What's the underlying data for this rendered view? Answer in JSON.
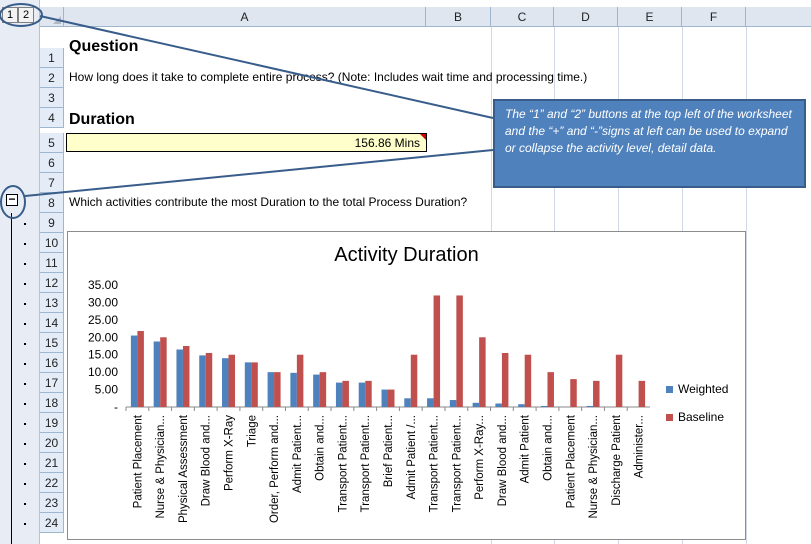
{
  "outline": {
    "level_buttons": [
      "1",
      "2"
    ],
    "collapse_symbol": "−"
  },
  "columns": [
    "A",
    "B",
    "C",
    "D",
    "E",
    "F"
  ],
  "rows": [
    "1",
    "2",
    "3",
    "4",
    "5",
    "6",
    "7",
    "8",
    "9",
    "10",
    "11",
    "12",
    "13",
    "14",
    "15",
    "16",
    "17",
    "18",
    "19",
    "20",
    "21",
    "22",
    "23",
    "24"
  ],
  "sheet": {
    "question_heading": "Question",
    "question_text": "How long does it take to complete entire process?  (Note: Includes wait time and processing time.)",
    "duration_heading": "Duration",
    "duration_value": "156.86  Mins",
    "contribution_text": "Which activities contribute the most Duration to the total Process Duration?"
  },
  "callout": {
    "text": "The “1” and “2” buttons at the top left of the worksheet and the “+” and “-”signs at left can be used to expand or collapse the activity level, detail data."
  },
  "colors": {
    "weighted": "#4f81bd",
    "baseline": "#c0504d",
    "callout_bg": "#4f81bd"
  },
  "chart_data": {
    "type": "bar",
    "title": "Activity Duration",
    "categories": [
      "Patient Placement",
      "Nurse & Physician...",
      "Physical Assessment",
      "Draw  Blood and...",
      "Perform X-Ray",
      "Triage",
      "Order, Perform and...",
      "Admit Patient...",
      "Obtain and...",
      "Transport Patient...",
      "Transport Patient...",
      "Brief Patient...",
      "Admit Patient /...",
      "Transport Patient...",
      "Transport Patient...",
      "Perform X-Ray...",
      "Draw  Blood and...",
      "Admit Patient",
      "Obtain and...",
      "Patient Placement",
      "Nurse & Physician...",
      "Discharge Patient",
      "Administer..."
    ],
    "y_ticks": [
      "35.00",
      "30.00",
      "25.00",
      "20.00",
      "15.00",
      "10.00",
      "5.00",
      "-"
    ],
    "ylim": [
      0,
      35
    ],
    "series": [
      {
        "name": "Weighted",
        "values": [
          20.5,
          18.8,
          16.5,
          14.8,
          14.0,
          12.8,
          10.0,
          9.8,
          9.3,
          7.0,
          7.0,
          5.0,
          2.5,
          2.5,
          2.0,
          1.2,
          1.0,
          0.8,
          0.3,
          0,
          0.3,
          0,
          0
        ]
      },
      {
        "name": "Baseline",
        "values": [
          21.8,
          20.0,
          17.5,
          15.5,
          15.0,
          12.8,
          10.0,
          15.0,
          10.0,
          7.5,
          7.5,
          5.0,
          15.0,
          32.0,
          32.0,
          20.0,
          15.5,
          15.0,
          10.0,
          8.0,
          7.5,
          15.0,
          7.5
        ]
      }
    ],
    "legend_position": "right",
    "grid": false
  }
}
